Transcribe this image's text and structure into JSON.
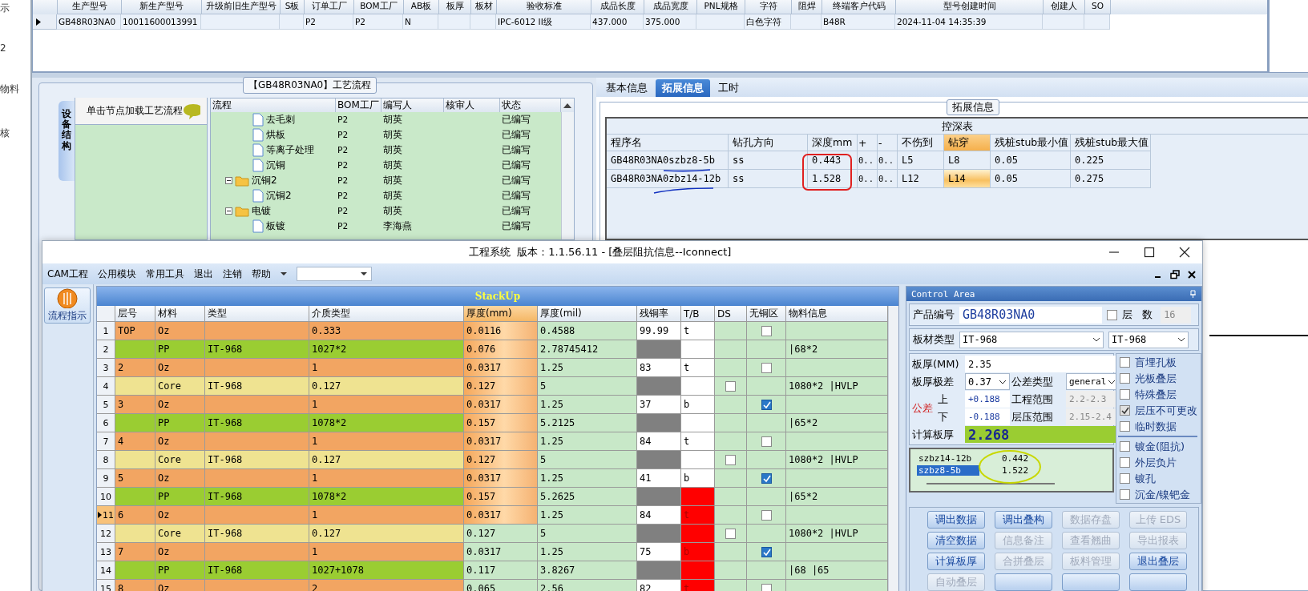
{
  "left_strip": {
    "items": [
      "示",
      "2",
      "物料",
      "核"
    ]
  },
  "top_grid": {
    "columns": [
      "生产型号",
      "新生产型号",
      "升级前旧生产型号",
      "S板",
      "订单工厂",
      "BOM工厂",
      "AB板",
      "板厚",
      "板材",
      "验收标准",
      "成品长度",
      "成品宽度",
      "PNL规格",
      "字符",
      "阻焊",
      "终端客户代码",
      "型号创建时间",
      "创建人",
      "SO"
    ],
    "rows": [
      {
        "current": true,
        "cells": [
          "GB48R03NA0",
          "10011600013991",
          null,
          null,
          "P2",
          "P2",
          "N",
          null,
          null,
          "IPC-6012 II级",
          "437.000",
          "375.000",
          null,
          "白色字符",
          null,
          "B48R",
          "2024-11-04 14:35:39",
          null,
          null
        ]
      }
    ]
  },
  "process_tree": {
    "title": "【GB48R03NA0】工艺流程",
    "side_tab": "设备结构",
    "hint": "单击节点加载工艺流程",
    "columns": [
      "流程",
      "BOM工厂",
      "编写人",
      "核审人",
      "状态"
    ],
    "nodes": [
      {
        "kind": "offscreen_parent",
        "children": [
          {
            "kind": "file",
            "name": "去毛刺",
            "bom": "P2",
            "writer": "胡英",
            "status": "已编写"
          },
          {
            "kind": "file",
            "name": "烘板",
            "bom": "P2",
            "writer": "胡英",
            "status": "已编写"
          },
          {
            "kind": "file",
            "name": "等离子处理",
            "bom": "P2",
            "writer": "胡英",
            "status": "已编写"
          },
          {
            "kind": "file",
            "name": "沉铜",
            "bom": "P2",
            "writer": "胡英",
            "status": "已编写"
          }
        ]
      },
      {
        "kind": "folder",
        "name": "沉铜2",
        "expanded": true,
        "bom": "P2",
        "writer": "胡英",
        "status": "已编写",
        "children": [
          {
            "kind": "file",
            "name": "沉铜2",
            "bom": "P2",
            "writer": "胡英",
            "status": "已编写"
          }
        ]
      },
      {
        "kind": "folder",
        "name": "电镀",
        "expanded": true,
        "bom": "P2",
        "writer": "胡英",
        "status": "已编写",
        "children": [
          {
            "kind": "file",
            "name": "板镀",
            "bom": "P2",
            "writer": "李海燕",
            "status": "已编写"
          }
        ]
      }
    ]
  },
  "detail_tabs": [
    {
      "label": "基本信息",
      "selected": false
    },
    {
      "label": "拓展信息",
      "selected": true
    },
    {
      "label": "工时",
      "selected": false
    }
  ],
  "ext_info": {
    "group_title": "拓展信息",
    "table_title": "控深表",
    "columns": [
      {
        "label": "程序名",
        "selected": false
      },
      {
        "label": "钻孔方向",
        "selected": false
      },
      {
        "label": "深度mm",
        "selected": false
      },
      {
        "label": "+",
        "selected": false
      },
      {
        "label": "-",
        "selected": false
      },
      {
        "label": "不伤到",
        "selected": false
      },
      {
        "label": "钻穿",
        "selected": true
      },
      {
        "label": "残桩stub最小值",
        "selected": false
      },
      {
        "label": "残桩stub最大值",
        "selected": false
      }
    ],
    "rows": [
      {
        "current": false,
        "cells": [
          "GB48R03NA0szbz8-5b",
          "ss",
          "0.443",
          "0..",
          "0..",
          "L5",
          "L8",
          "0.05",
          "0.225"
        ]
      },
      {
        "current": true,
        "cells": [
          "GB48R03NA0zbz14-12b",
          "ss",
          "1.528",
          "0..",
          "0..",
          "L12",
          "L14",
          "0.05",
          "0.275"
        ]
      }
    ]
  },
  "window": {
    "title": "工程系统  版本：1.1.56.11 - [叠层阻抗信息--Iconnect]",
    "menu": [
      "CAM工程",
      "公用模块",
      "常用工具",
      "退出",
      "注销",
      "帮助"
    ],
    "side_button": "流程指示",
    "stackup": {
      "title": "StackUp",
      "columns": [
        "层号",
        "材料",
        "类型",
        "介质类型",
        "厚度(mm)",
        "厚度(mil)",
        "残铜率",
        "T/B",
        "DS",
        "无铜区",
        "物料信息"
      ],
      "rows": [
        {
          "no": "1",
          "kind": "copper",
          "layer": "TOP",
          "material": "Oz",
          "dielectric": "0.333",
          "mm": "0.0116",
          "mil": "0.4588",
          "copper": "99.99",
          "tb": "t",
          "tb_alert": false,
          "no_copper": false,
          "mm_highlight": true,
          "current": false
        },
        {
          "no": "2",
          "kind": "prepreg",
          "material": "PP",
          "type": "IT-968",
          "dielectric": "1027*2",
          "mm": "0.076",
          "mil": "2.78745412",
          "tb_alert": false,
          "info": "|68*2",
          "mm_highlight": true,
          "current": false
        },
        {
          "no": "3",
          "kind": "copper",
          "layer": "2",
          "material": "Oz",
          "dielectric": "1",
          "mm": "0.0317",
          "mil": "1.25",
          "copper": "83",
          "tb": "t",
          "tb_alert": false,
          "no_copper": false,
          "mm_highlight": true,
          "current": false
        },
        {
          "no": "4",
          "kind": "core",
          "material": "Core",
          "type": "IT-968",
          "dielectric": "0.127",
          "mm": "0.127",
          "mil": "5",
          "tb_alert": false,
          "ds": false,
          "info": "1080*2 |HVLP",
          "mm_highlight": true,
          "current": false
        },
        {
          "no": "5",
          "kind": "copper",
          "layer": "3",
          "material": "Oz",
          "dielectric": "1",
          "mm": "0.0317",
          "mil": "1.25",
          "copper": "37",
          "tb": "b",
          "tb_alert": false,
          "no_copper": true,
          "mm_highlight": true,
          "current": false
        },
        {
          "no": "6",
          "kind": "prepreg",
          "material": "PP",
          "type": "IT-968",
          "dielectric": "1078*2",
          "mm": "0.157",
          "mil": "5.2125",
          "tb_alert": false,
          "info": "|65*2",
          "mm_highlight": true,
          "current": false
        },
        {
          "no": "7",
          "kind": "copper",
          "layer": "4",
          "material": "Oz",
          "dielectric": "1",
          "mm": "0.0317",
          "mil": "1.25",
          "copper": "84",
          "tb": "t",
          "tb_alert": false,
          "no_copper": false,
          "mm_highlight": true,
          "current": false
        },
        {
          "no": "8",
          "kind": "core",
          "material": "Core",
          "type": "IT-968",
          "dielectric": "0.127",
          "mm": "0.127",
          "mil": "5",
          "tb_alert": false,
          "ds": false,
          "info": "1080*2 |HVLP",
          "mm_highlight": true,
          "current": false
        },
        {
          "no": "9",
          "kind": "copper",
          "layer": "5",
          "material": "Oz",
          "dielectric": "1",
          "mm": "0.0317",
          "mil": "1.25",
          "copper": "41",
          "tb": "b",
          "tb_alert": false,
          "no_copper": true,
          "mm_highlight": true,
          "current": false
        },
        {
          "no": "10",
          "kind": "prepreg",
          "material": "PP",
          "type": "IT-968",
          "dielectric": "1078*2",
          "mm": "0.157",
          "mil": "5.2625",
          "tb_alert": true,
          "info": "|65*2",
          "mm_highlight": true,
          "current": false
        },
        {
          "no": "11",
          "kind": "copper",
          "layer": "6",
          "material": "Oz",
          "dielectric": "1",
          "mm": "0.0317",
          "mil": "1.25",
          "copper": "84",
          "tb": "t",
          "tb_alert": true,
          "no_copper": false,
          "mm_highlight": true,
          "current": true
        },
        {
          "no": "12",
          "kind": "core",
          "material": "Core",
          "type": "IT-968",
          "dielectric": "0.127",
          "mm": "0.127",
          "mil": "5",
          "tb_alert": true,
          "ds": false,
          "info": "1080*2 |HVLP",
          "mm_highlight": false,
          "current": false
        },
        {
          "no": "13",
          "kind": "copper",
          "layer": "7",
          "material": "Oz",
          "dielectric": "1",
          "mm": "0.0317",
          "mil": "1.25",
          "copper": "75",
          "tb": "b",
          "tb_alert": true,
          "no_copper": true,
          "mm_highlight": false,
          "current": false
        },
        {
          "no": "14",
          "kind": "prepreg",
          "material": "PP",
          "type": "IT-968",
          "dielectric": "1027+1078",
          "mm": "0.117",
          "mil": "3.8267",
          "tb_alert": true,
          "info": "|68 |65",
          "mm_highlight": false,
          "current": false
        },
        {
          "no": "15",
          "kind": "copper",
          "layer": "8",
          "material": "Oz",
          "dielectric": "2",
          "mm": "0.065",
          "mil": "2.56",
          "copper": "82",
          "tb": "t",
          "tb_alert": true,
          "no_copper": false,
          "mm_highlight": false,
          "current": false
        }
      ]
    },
    "control_area": {
      "title": "Control Area",
      "product_label": "产品编号",
      "product": "GB48R03NA0",
      "layers_label": "层 数",
      "layers_checked": false,
      "layers": "16",
      "board_label": "板材类型",
      "board": "IT-968",
      "board2": "IT-968",
      "thickness_label": "板厚(MM)",
      "thickness": "2.35",
      "range_label": "板厚极差",
      "range": "0.37",
      "tol_type_label": "公差类型",
      "tol_type": "general",
      "tol_label": "公差",
      "upper_label": "上",
      "upper": "+0.188",
      "eng_label": "工程范围",
      "eng": "2.2-2.3",
      "lower_label": "下",
      "lower": "-0.188",
      "lam_label": "层压范围",
      "lam": "2.15-2.4",
      "calc_label": "计算板厚",
      "calc": "2.268",
      "results": [
        {
          "name": "szbz14-12b",
          "value": "0.442",
          "selected": false
        },
        {
          "name": "szbz8-5b",
          "value": "1.522",
          "selected": true
        }
      ],
      "options": [
        {
          "label": "盲埋孔板",
          "checked": false
        },
        {
          "label": "光板叠层",
          "checked": false
        },
        {
          "label": "特殊叠层",
          "checked": false
        },
        {
          "label": "层压不可更改",
          "checked": true
        },
        {
          "label": "临时数据",
          "checked": false
        }
      ],
      "options2": [
        {
          "label": "镀金(阻抗)",
          "checked": false
        },
        {
          "label": "外层负片",
          "checked": false
        },
        {
          "label": "镀孔",
          "checked": false
        },
        {
          "label": "沉金/镍钯金",
          "checked": false
        }
      ],
      "buttons": [
        {
          "label": "调出数据",
          "disabled": false
        },
        {
          "label": "调出叠构",
          "disabled": false
        },
        {
          "label": "数据存盘",
          "disabled": true
        },
        {
          "label": "上传 EDS",
          "disabled": true
        },
        {
          "label": "清空数据",
          "disabled": false
        },
        {
          "label": "信息备注",
          "disabled": true
        },
        {
          "label": "查看翘曲",
          "disabled": true
        },
        {
          "label": "导出报表",
          "disabled": true
        },
        {
          "label": "计算板厚",
          "disabled": false
        },
        {
          "label": "合拼叠层",
          "disabled": true
        },
        {
          "label": "板料管理",
          "disabled": true
        },
        {
          "label": "退出叠层",
          "disabled": false
        },
        {
          "label": "自动叠层",
          "disabled": true
        },
        {
          "disabled": false
        },
        {
          "disabled": false
        },
        {
          "disabled": false
        }
      ]
    }
  }
}
